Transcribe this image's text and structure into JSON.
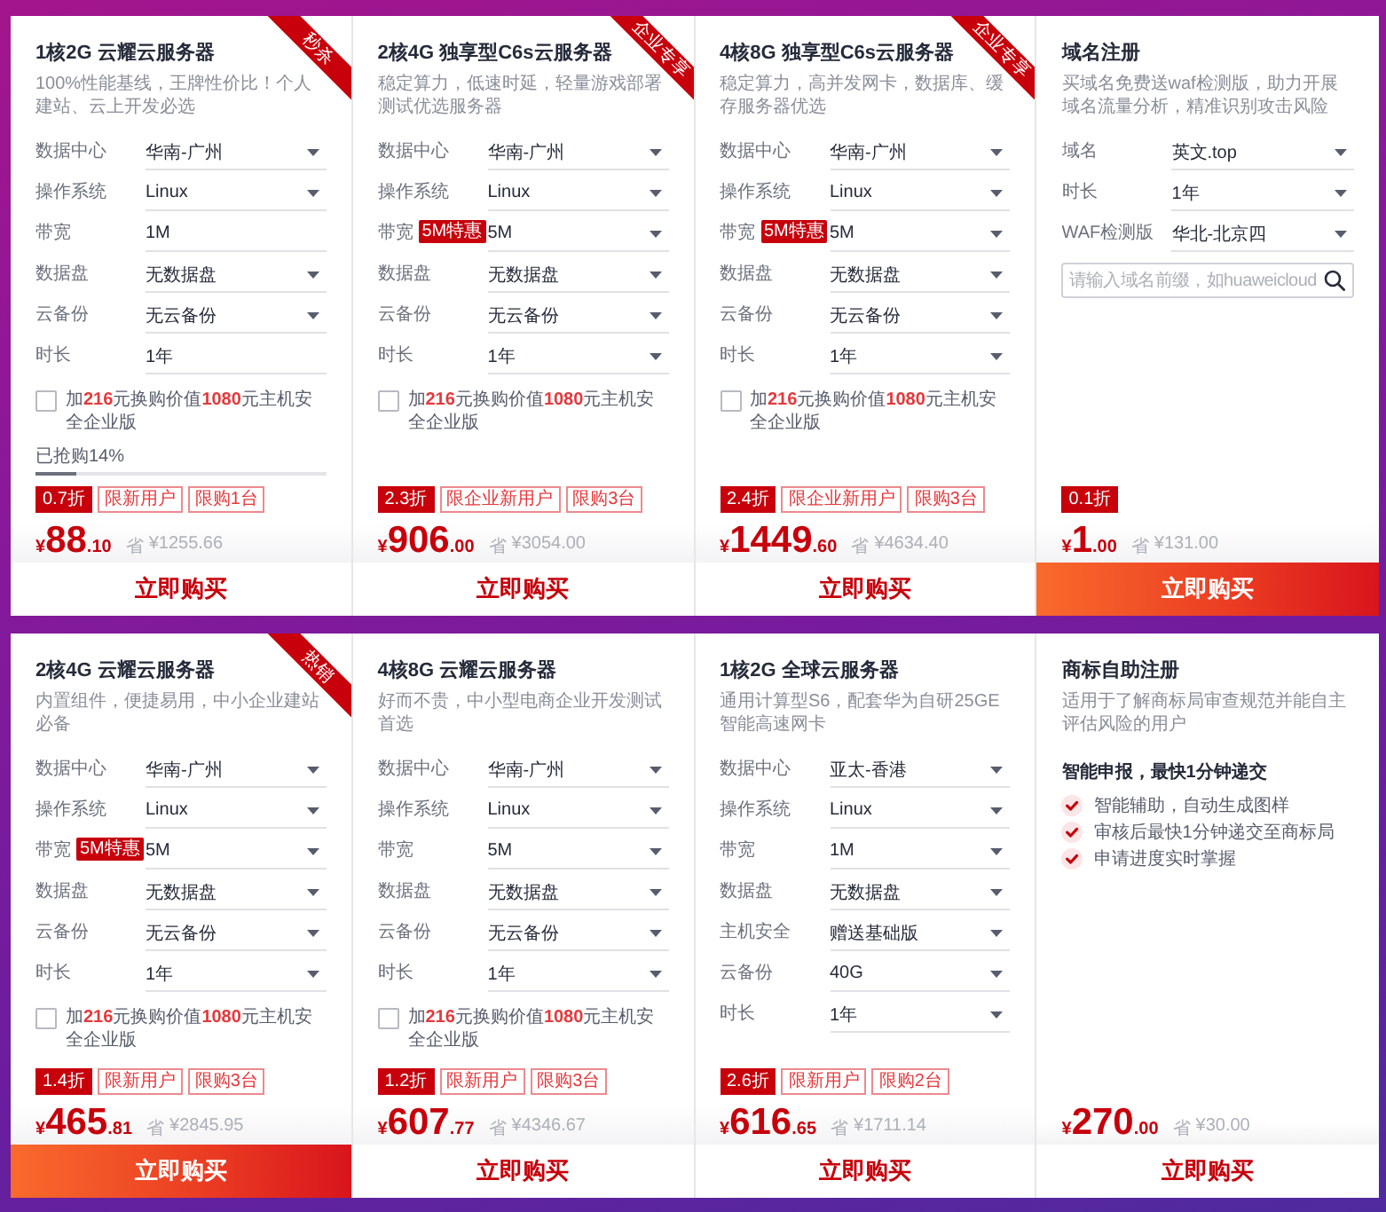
{
  "products": [
    {
      "title": "1核2G 云耀云服务器",
      "subtitle": "100%性能基线，王牌性价比！个人建站、云上开发必选",
      "ribbon": "秒杀",
      "fields": [
        {
          "label": "数据中心",
          "value": "华南-广州",
          "dropdown": true
        },
        {
          "label": "操作系统",
          "value": "Linux",
          "dropdown": true
        },
        {
          "label": "带宽",
          "value": "1M",
          "dropdown": false
        },
        {
          "label": "数据盘",
          "value": "无数据盘",
          "dropdown": true
        },
        {
          "label": "云备份",
          "value": "无云备份",
          "dropdown": true
        },
        {
          "label": "时长",
          "value": "1年",
          "dropdown": false
        }
      ],
      "addon": {
        "text": "加**216**元换购价值**1080**元主机安全企业版",
        "checked": false
      },
      "progress": {
        "label": "已抢购14%",
        "level": 0.14
      },
      "tags": [
        {
          "text": "0.7折",
          "kind": "discount"
        },
        {
          "text": "限新用户",
          "kind": "limit"
        },
        {
          "text": "限购1台",
          "kind": "limit"
        }
      ],
      "price": {
        "currency": "¥",
        "integer": "88",
        "decimal": ".10"
      },
      "saving": {
        "mark": "省",
        "amount": "¥1255.66"
      },
      "button": {
        "label": "立即购买",
        "highlighted": false
      }
    },
    {
      "title": "2核4G 独享型C6s云服务器",
      "subtitle": "稳定算力，低速时延，轻量游戏部署测试优选服务器",
      "ribbon": "企业专享",
      "fields": [
        {
          "label": "数据中心",
          "value": "华南-广州",
          "dropdown": true
        },
        {
          "label": "操作系统",
          "value": "Linux",
          "dropdown": true
        },
        {
          "label": "带宽",
          "badge": "5M特惠",
          "value": "5M",
          "dropdown": true
        },
        {
          "label": "数据盘",
          "value": "无数据盘",
          "dropdown": true
        },
        {
          "label": "云备份",
          "value": "无云备份",
          "dropdown": true
        },
        {
          "label": "时长",
          "value": "1年",
          "dropdown": true
        }
      ],
      "addon": {
        "text": "加**216**元换购价值**1080**元主机安全企业版",
        "checked": false
      },
      "tags": [
        {
          "text": "2.3折",
          "kind": "discount"
        },
        {
          "text": "限企业新用户",
          "kind": "limit"
        },
        {
          "text": "限购3台",
          "kind": "limit"
        }
      ],
      "price": {
        "currency": "¥",
        "integer": "906",
        "decimal": ".00"
      },
      "saving": {
        "mark": "省",
        "amount": "¥3054.00"
      },
      "button": {
        "label": "立即购买",
        "highlighted": false
      }
    },
    {
      "title": "4核8G 独享型C6s云服务器",
      "subtitle": "稳定算力，高并发网卡，数据库、缓存服务器优选",
      "ribbon": "企业专享",
      "fields": [
        {
          "label": "数据中心",
          "value": "华南-广州",
          "dropdown": true
        },
        {
          "label": "操作系统",
          "value": "Linux",
          "dropdown": true
        },
        {
          "label": "带宽",
          "badge": "5M特惠",
          "value": "5M",
          "dropdown": true
        },
        {
          "label": "数据盘",
          "value": "无数据盘",
          "dropdown": true
        },
        {
          "label": "云备份",
          "value": "无云备份",
          "dropdown": true
        },
        {
          "label": "时长",
          "value": "1年",
          "dropdown": true
        }
      ],
      "addon": {
        "text": "加**216**元换购价值**1080**元主机安全企业版",
        "checked": false
      },
      "tags": [
        {
          "text": "2.4折",
          "kind": "discount"
        },
        {
          "text": "限企业新用户",
          "kind": "limit"
        },
        {
          "text": "限购3台",
          "kind": "limit"
        }
      ],
      "price": {
        "currency": "¥",
        "integer": "1449",
        "decimal": ".60"
      },
      "saving": {
        "mark": "省",
        "amount": "¥4634.40"
      },
      "button": {
        "label": "立即购买",
        "highlighted": false
      }
    },
    {
      "title": "域名注册",
      "subtitle": "买域名免费送waf检测版，助力开展域名流量分析，精准识别攻击风险",
      "fields": [
        {
          "label": "域名",
          "value": "英文.top",
          "dropdown": true
        },
        {
          "label": "时长",
          "value": "1年",
          "dropdown": true
        },
        {
          "label": "WAF检测版",
          "value": "华北-北京四",
          "dropdown": true
        }
      ],
      "search": {
        "placeholder": "请输入域名前缀，如huaweicloud"
      },
      "tags": [
        {
          "text": "0.1折",
          "kind": "discount"
        }
      ],
      "price": {
        "currency": "¥",
        "integer": "1",
        "decimal": ".00"
      },
      "saving": {
        "mark": "省",
        "amount": "¥131.00"
      },
      "button": {
        "label": "立即购买",
        "highlighted": true
      }
    },
    {
      "title": "2核4G 云耀云服务器",
      "subtitle": "内置组件，便捷易用，中小企业建站必备",
      "ribbon": "热销",
      "fields": [
        {
          "label": "数据中心",
          "value": "华南-广州",
          "dropdown": true
        },
        {
          "label": "操作系统",
          "value": "Linux",
          "dropdown": true
        },
        {
          "label": "带宽",
          "badge": "5M特惠",
          "value": "5M",
          "dropdown": true
        },
        {
          "label": "数据盘",
          "value": "无数据盘",
          "dropdown": true
        },
        {
          "label": "云备份",
          "value": "无云备份",
          "dropdown": true
        },
        {
          "label": "时长",
          "value": "1年",
          "dropdown": true
        }
      ],
      "addon": {
        "text": "加**216**元换购价值**1080**元主机安全企业版",
        "checked": false
      },
      "tags": [
        {
          "text": "1.4折",
          "kind": "discount"
        },
        {
          "text": "限新用户",
          "kind": "limit"
        },
        {
          "text": "限购3台",
          "kind": "limit"
        }
      ],
      "price": {
        "currency": "¥",
        "integer": "465",
        "decimal": ".81"
      },
      "saving": {
        "mark": "省",
        "amount": "¥2845.95"
      },
      "button": {
        "label": "立即购买",
        "highlighted": true
      }
    },
    {
      "title": "4核8G 云耀云服务器",
      "subtitle": "好而不贵，中小型电商企业开发测试首选",
      "fields": [
        {
          "label": "数据中心",
          "value": "华南-广州",
          "dropdown": true
        },
        {
          "label": "操作系统",
          "value": "Linux",
          "dropdown": true
        },
        {
          "label": "带宽",
          "value": "5M",
          "dropdown": true
        },
        {
          "label": "数据盘",
          "value": "无数据盘",
          "dropdown": true
        },
        {
          "label": "云备份",
          "value": "无云备份",
          "dropdown": true
        },
        {
          "label": "时长",
          "value": "1年",
          "dropdown": true
        }
      ],
      "addon": {
        "text": "加**216**元换购价值**1080**元主机安全企业版",
        "checked": false
      },
      "tags": [
        {
          "text": "1.2折",
          "kind": "discount"
        },
        {
          "text": "限新用户",
          "kind": "limit"
        },
        {
          "text": "限购3台",
          "kind": "limit"
        }
      ],
      "price": {
        "currency": "¥",
        "integer": "607",
        "decimal": ".77"
      },
      "saving": {
        "mark": "省",
        "amount": "¥4346.67"
      },
      "button": {
        "label": "立即购买",
        "highlighted": false
      }
    },
    {
      "title": "1核2G 全球云服务器",
      "subtitle": "通用计算型S6，配套华为自研25GE智能高速网卡",
      "fields": [
        {
          "label": "数据中心",
          "value": "亚太-香港",
          "dropdown": true
        },
        {
          "label": "操作系统",
          "value": "Linux",
          "dropdown": true
        },
        {
          "label": "带宽",
          "value": "1M",
          "dropdown": true
        },
        {
          "label": "数据盘",
          "value": "无数据盘",
          "dropdown": true
        },
        {
          "label": "主机安全",
          "value": "赠送基础版",
          "dropdown": true
        },
        {
          "label": "云备份",
          "value": "40G",
          "dropdown": true
        },
        {
          "label": "时长",
          "value": "1年",
          "dropdown": true
        }
      ],
      "tags": [
        {
          "text": "2.6折",
          "kind": "discount"
        },
        {
          "text": "限新用户",
          "kind": "limit"
        },
        {
          "text": "限购2台",
          "kind": "limit"
        }
      ],
      "price": {
        "currency": "¥",
        "integer": "616",
        "decimal": ".65"
      },
      "saving": {
        "mark": "省",
        "amount": "¥1711.14"
      },
      "button": {
        "label": "立即购买",
        "highlighted": false
      }
    },
    {
      "title": "商标自助注册",
      "subtitle": "适用于了解商标局审查规范并能自主评估风险的用户",
      "highlight": "智能申报，最快1分钟递交",
      "features": [
        "智能辅助，自动生成图样",
        "审核后最快1分钟递交至商标局",
        "申请进度实时掌握"
      ],
      "price": {
        "currency": "¥",
        "integer": "270",
        "decimal": ".00"
      },
      "saving": {
        "mark": "省",
        "amount": "¥30.00"
      },
      "button": {
        "label": "立即购买",
        "highlighted": false
      }
    }
  ]
}
